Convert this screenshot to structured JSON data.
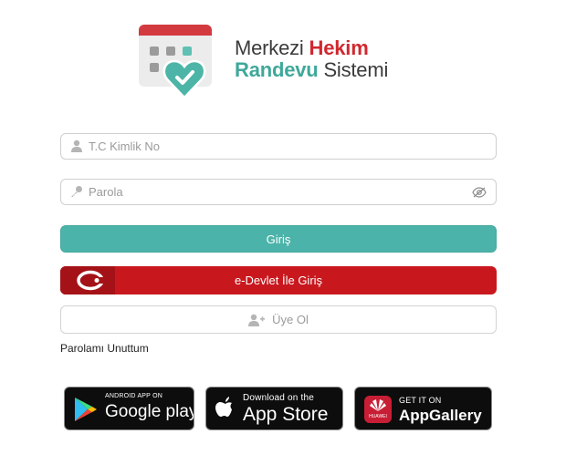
{
  "logo": {
    "word1": "Merkezi",
    "word2": "Hekim",
    "word3": "Randevu",
    "word4": "Sistemi"
  },
  "form": {
    "tc_placeholder": "T.C Kimlik No",
    "password_placeholder": "Parola",
    "login_label": "Giriş",
    "edevlet_label": "e-Devlet İle Giriş",
    "register_label": "Üye Ol",
    "forgot_label": "Parolamı Unuttum"
  },
  "stores": {
    "google": {
      "small": "ANDROID APP ON",
      "big": "Google play"
    },
    "apple": {
      "small": "Download on the",
      "big": "App Store"
    },
    "huawei": {
      "small": "GET IT ON",
      "big": "AppGallery",
      "sub": "HUAWEI"
    }
  },
  "colors": {
    "teal": "#4bb3a9",
    "red": "#c8181e",
    "brand_red": "#d0282f",
    "brand_teal": "#3fa89a"
  },
  "icons": {
    "user": "user-icon",
    "key": "key-icon",
    "eye": "eye-icon",
    "add_user": "add-user-icon"
  }
}
